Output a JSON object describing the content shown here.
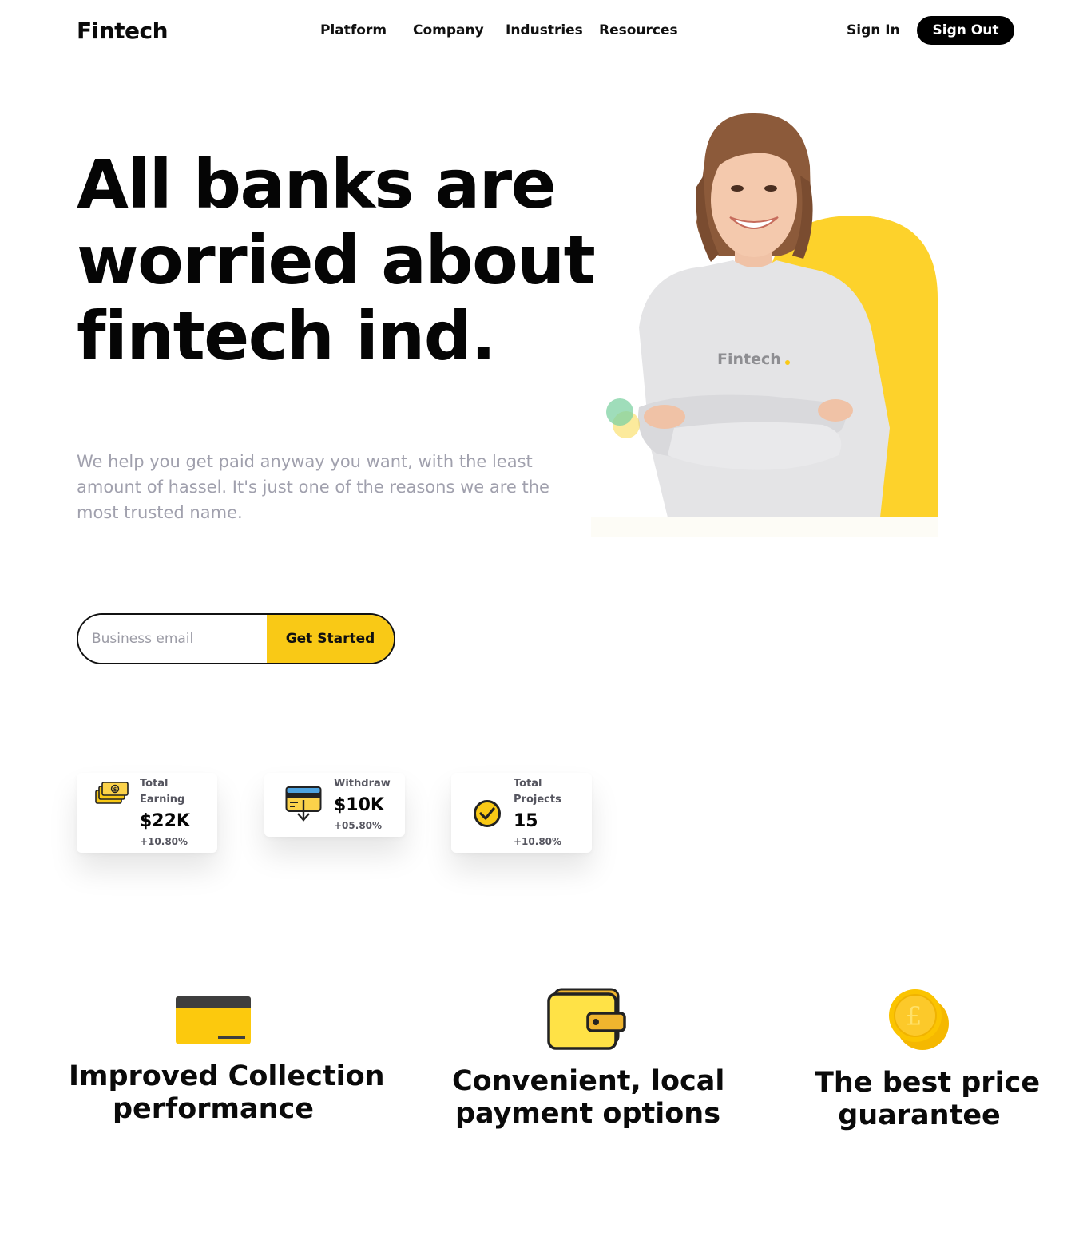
{
  "brand": {
    "logo_text": "Fintech"
  },
  "nav": {
    "items": [
      {
        "label": "Platform"
      },
      {
        "label": "Company"
      },
      {
        "label": "Industries"
      },
      {
        "label": "Resources"
      }
    ],
    "sign_in": "Sign In",
    "sign_out": "Sign Out"
  },
  "hero": {
    "title": "All banks are worried about fintech ind.",
    "subtitle": "We help you get paid anyway you want, with the least amount of hassel. It's just one of the reasons we are the most trusted name.",
    "shirt_text": "Fintech"
  },
  "signup": {
    "email_placeholder": "Business email",
    "button_label": "Get Started"
  },
  "stats": [
    {
      "label_line1": "Total",
      "label_line2": "Earning",
      "value": "$22K",
      "change": "+10.80%",
      "icon": "cash-icon"
    },
    {
      "label_line1": "Withdraw",
      "value": "$10K",
      "change": "+05.80%",
      "icon": "card-withdraw-icon"
    },
    {
      "label_line1": "Total",
      "label_line2": "Projects",
      "value": "15",
      "change": "+10.80%",
      "icon": "check-circle-icon"
    }
  ],
  "features": [
    {
      "line1": "Improved Collection",
      "line2": "performance",
      "icon": "credit-card-icon"
    },
    {
      "line1": "Convenient, local",
      "line2": "payment options",
      "icon": "wallet-icon"
    },
    {
      "line1": "The best price",
      "line2": "guarantee",
      "icon": "coins-icon"
    }
  ],
  "colors": {
    "accent_yellow": "#f9c916",
    "text_dark": "#050505",
    "text_muted": "#a0a0ad",
    "button_dark": "#000000"
  }
}
